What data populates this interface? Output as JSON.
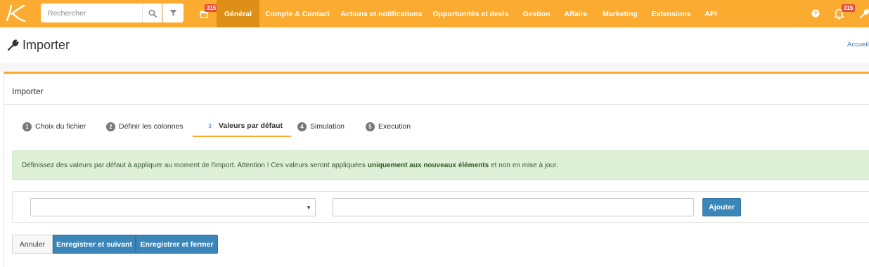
{
  "search": {
    "placeholder": "Rechercher"
  },
  "icons": {
    "logo": "k-logo",
    "search": "search-icon",
    "filter": "filter-icon",
    "calendar": "calendar-icon",
    "help": "help-icon",
    "bell": "bell-icon",
    "wrench": "wrench-icon"
  },
  "header": {
    "calendar_badge": "315",
    "notifications_badge": "315",
    "nav": [
      {
        "label": "Général",
        "active": true
      },
      {
        "label": "Compte & Contact"
      },
      {
        "label": "Actions et notifications"
      },
      {
        "label": "Opportunités et devis"
      },
      {
        "label": "Gestion"
      },
      {
        "label": "Affaire"
      },
      {
        "label": "Marketing"
      },
      {
        "label": "Extensions"
      },
      {
        "label": "API"
      }
    ]
  },
  "page": {
    "title": "Importer",
    "breadcrumb": "Accueil"
  },
  "panel": {
    "title": "Importer",
    "steps": [
      {
        "num": "1",
        "label": "Choix du fichier"
      },
      {
        "num": "2",
        "label": "Définir les colonnes"
      },
      {
        "num": "3",
        "label": "Valeurs par défaut",
        "active": true
      },
      {
        "num": "4",
        "label": "Simulation"
      },
      {
        "num": "5",
        "label": "Execution"
      }
    ],
    "alert": {
      "before": "Définissez des valeurs par défaut à appliquer au moment de l'import. Attention ! Ces valeurs seront appliquées",
      "strong": "uniquement aux nouveaux éléments",
      "after": "et non en mise à jour."
    },
    "form": {
      "select_value": "",
      "input_value": "",
      "add_button": "Ajouter"
    },
    "buttons": {
      "cancel": "Annuler",
      "save_next": "Enregistrer et suivant",
      "save_close": "Enregistrer et fermer"
    }
  },
  "colors": {
    "brand": "#fbab2f",
    "brand_active": "#dd8f17",
    "primary": "#3a86b9",
    "badge": "#e84d3d",
    "alert_bg": "#dff0d8"
  }
}
